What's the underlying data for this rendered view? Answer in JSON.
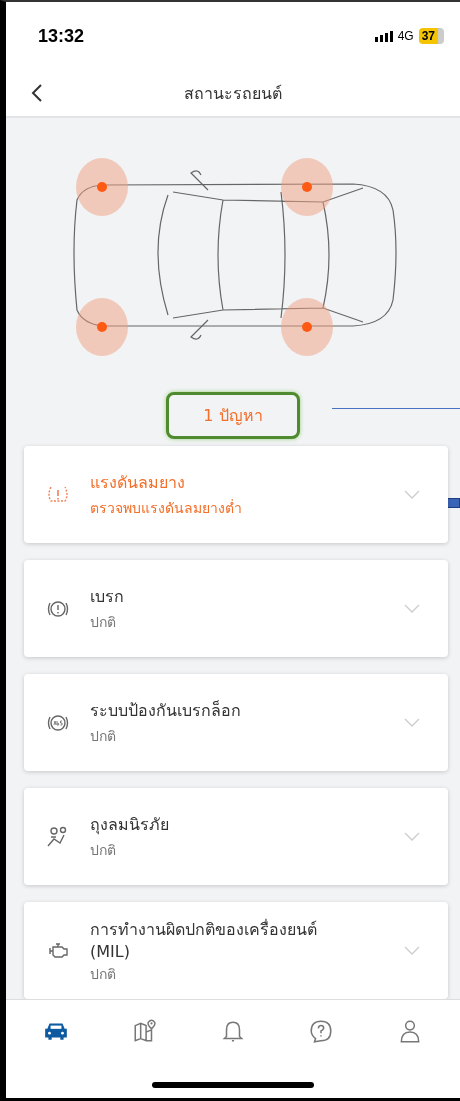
{
  "status_bar": {
    "time": "13:32",
    "network": "4G",
    "battery": "37"
  },
  "header": {
    "title": "สถานะรถยนต์"
  },
  "car": {
    "tires": [
      {
        "alert": true
      },
      {
        "alert": true
      },
      {
        "alert": true
      },
      {
        "alert": true
      }
    ]
  },
  "issue_badge": {
    "label": "1 ปัญหา"
  },
  "items": [
    {
      "kind": "tire",
      "title": "แรงดันลมยาง",
      "status": "ตรวจพบแรงดันลมยางต่ำ",
      "warning": true
    },
    {
      "kind": "brake",
      "title": "เบรก",
      "status": "ปกติ",
      "warning": false
    },
    {
      "kind": "abs",
      "title": "ระบบป้องกันเบรกล็อก",
      "status": "ปกติ",
      "warning": false
    },
    {
      "kind": "airbag",
      "title": "ถุงลมนิรภัย",
      "status": "ปกติ",
      "warning": false
    },
    {
      "kind": "engine",
      "title": "การทำงานผิดปกติของเครื่องยนต์\n(MIL)",
      "status": "ปกติ",
      "warning": false
    }
  ],
  "tab_bar": [
    {
      "kind": "car",
      "selected": true
    },
    {
      "kind": "map",
      "selected": false
    },
    {
      "kind": "bell",
      "selected": false
    },
    {
      "kind": "help",
      "selected": false
    },
    {
      "kind": "person",
      "selected": false
    }
  ]
}
